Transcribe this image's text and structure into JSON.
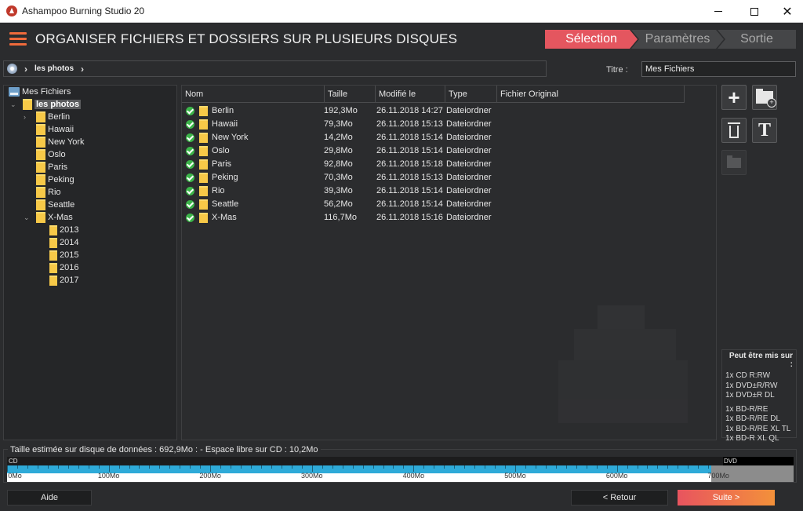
{
  "window": {
    "title": "Ashampoo Burning Studio 20"
  },
  "header": {
    "title": "ORGANISER FICHIERS ET DOSSIERS SUR PLUSIEURS DISQUES"
  },
  "steps": [
    "Sélection",
    "Paramètres",
    "Sortie"
  ],
  "breadcrumb": {
    "items": [
      "les photos"
    ]
  },
  "titre": {
    "label": "Titre :",
    "value": "Mes Fichiers"
  },
  "tree": {
    "root": "Mes Fichiers",
    "selected": "les photos",
    "folders": [
      "Berlin",
      "Hawaii",
      "New York",
      "Oslo",
      "Paris",
      "Peking",
      "Rio",
      "Seattle",
      "X-Mas"
    ],
    "xmas_children": [
      "2013",
      "2014",
      "2015",
      "2016",
      "2017"
    ]
  },
  "list": {
    "columns": [
      "Nom",
      "Taille",
      "Modifié le",
      "Type",
      "Fichier Original"
    ],
    "rows": [
      {
        "name": "Berlin",
        "size": "192,3Mo",
        "date": "26.11.2018 14:27",
        "type": "Dateiordner"
      },
      {
        "name": "Hawaii",
        "size": "79,3Mo",
        "date": "26.11.2018 15:13",
        "type": "Dateiordner"
      },
      {
        "name": "New York",
        "size": "14,2Mo",
        "date": "26.11.2018 15:14",
        "type": "Dateiordner"
      },
      {
        "name": "Oslo",
        "size": "29,8Mo",
        "date": "26.11.2018 15:14",
        "type": "Dateiordner"
      },
      {
        "name": "Paris",
        "size": "92,8Mo",
        "date": "26.11.2018 15:18",
        "type": "Dateiordner"
      },
      {
        "name": "Peking",
        "size": "70,3Mo",
        "date": "26.11.2018 15:13",
        "type": "Dateiordner"
      },
      {
        "name": "Rio",
        "size": "39,3Mo",
        "date": "26.11.2018 15:14",
        "type": "Dateiordner"
      },
      {
        "name": "Seattle",
        "size": "56,2Mo",
        "date": "26.11.2018 15:14",
        "type": "Dateiordner"
      },
      {
        "name": "X-Mas",
        "size": "116,7Mo",
        "date": "26.11.2018 15:16",
        "type": "Dateiordner"
      }
    ]
  },
  "actions": {
    "add_icon": "plus-icon",
    "new_folder_icon": "new-folder-icon",
    "delete_icon": "trash-icon",
    "rename_icon": "rename-icon",
    "open_folder_icon": "folder-icon"
  },
  "compat": {
    "header": "Peut être mis sur :",
    "group1": [
      "1x CD R:RW",
      "1x DVD±R/RW",
      "1x DVD±R DL"
    ],
    "group2": [
      "1x BD-R/RE",
      "1x BD-R/RE DL",
      "1x BD-R/RE XL TL",
      "1x BD-R XL QL"
    ]
  },
  "capacity": {
    "label": "Taille estimée sur disque de données : 692,9Mo : - Espace libre sur CD : 10,2Mo",
    "cd_label": "CD",
    "dvd_label": "DVD",
    "used_mb": 692.9,
    "scale_max_mb": 770,
    "ticks": [
      "0Mo",
      "100Mo",
      "200Mo",
      "300Mo",
      "400Mo",
      "500Mo",
      "600Mo",
      "700Mo"
    ]
  },
  "footer": {
    "help": "Aide",
    "back": "< Retour",
    "next": "Suite >"
  },
  "colors": {
    "accent": "#e4565f",
    "next_gradient_end": "#f3913a",
    "capacity_fill": "#2eaad8",
    "folder": "#f7c948",
    "status_ok": "#3cb54a"
  }
}
